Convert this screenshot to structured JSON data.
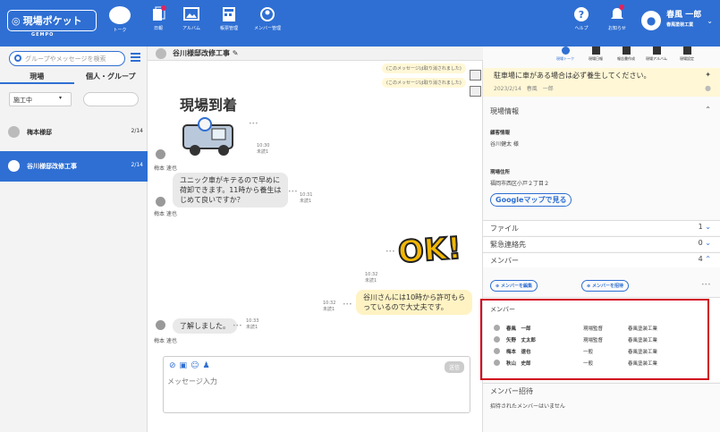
{
  "header": {
    "logo": "現場ポケット",
    "logo_sub": "GEMPO",
    "nav": [
      {
        "label": "トーク",
        "icon": "chat-icon"
      },
      {
        "label": "日報",
        "icon": "report-icon"
      },
      {
        "label": "アルバム",
        "icon": "album-icon"
      },
      {
        "label": "帳票管理",
        "icon": "form-icon"
      },
      {
        "label": "メンバー管理",
        "icon": "members-icon"
      }
    ],
    "help": "ヘルプ",
    "notice": "お知らせ",
    "user_name": "春風 一郎",
    "user_company": "春風塗装工業"
  },
  "sidebar": {
    "search_placeholder": "グループやメッセージを検索",
    "tabs": [
      "現場",
      "個人・グループ"
    ],
    "status_select": "施工中",
    "rooms": [
      {
        "name": "梅本様邸",
        "date": "2/14"
      },
      {
        "name": "谷川様邸改修工事",
        "date": "2/14"
      }
    ]
  },
  "chat": {
    "title": "谷川様邸改修工事",
    "system_messages": [
      "(このメッセージは取り消されました)",
      "(このメッセージは取り消されました)"
    ],
    "stamp1_text": "現場到着",
    "m1": {
      "time": "10:30",
      "read": "未読1",
      "name": "梅本 速也"
    },
    "m2": {
      "lines": [
        "ユニック車がキテるので早めに",
        "荷卸できます。11時から養生は",
        "じめて良いですか？"
      ],
      "time": "10:31",
      "read": "未読1",
      "name": "梅本 速也"
    },
    "m3": {
      "stamp": "OK!",
      "time": "10:32",
      "read": "未読1"
    },
    "m4": {
      "lines": [
        "谷川さんには10時から許可もら",
        "っているので大丈夫です。"
      ],
      "time": "10:32",
      "read": "未読1"
    },
    "m5": {
      "text": "了解しました。",
      "time": "10:33",
      "read": "未読1",
      "name": "梅本 速也"
    },
    "composer": {
      "placeholder": "メッセージ入力",
      "send": "送信"
    }
  },
  "right": {
    "tabs": [
      "現場トーク",
      "現場日報",
      "報告書作成",
      "現場アルバム",
      "現場設定"
    ],
    "pinned": {
      "text": "駐車場に車がある場合は必ず養生してください。",
      "meta": "2023/2/14　春風　一郎"
    },
    "site_info_title": "現場情報",
    "client_label": "顧客情報",
    "client": "谷川健太 様",
    "address_label": "現場住所",
    "address": "福岡市西区小戸２丁目２",
    "map_button": "Googleマップで見る",
    "files": {
      "label": "ファイル",
      "count": "1"
    },
    "emergency": {
      "label": "緊急連絡先",
      "count": "0"
    },
    "members": {
      "label": "メンバー",
      "count": "4"
    },
    "edit_members": "メンバーを編集",
    "invite_members": "メンバーを招待",
    "member_list_title": "メンバー",
    "member_list": [
      {
        "name": "春風　一郎",
        "role": "現場監督",
        "company": "春風塗装工業"
      },
      {
        "name": "矢野　丈太郎",
        "role": "現場監督",
        "company": "春風塗装工業"
      },
      {
        "name": "梅本　速也",
        "role": "一般",
        "company": "春風塗装工業"
      },
      {
        "name": "秋山　史郎",
        "role": "一般",
        "company": "春風塗装工業"
      }
    ],
    "invite_title": "メンバー招待",
    "invite_empty": "招待されたメンバーはいません"
  }
}
